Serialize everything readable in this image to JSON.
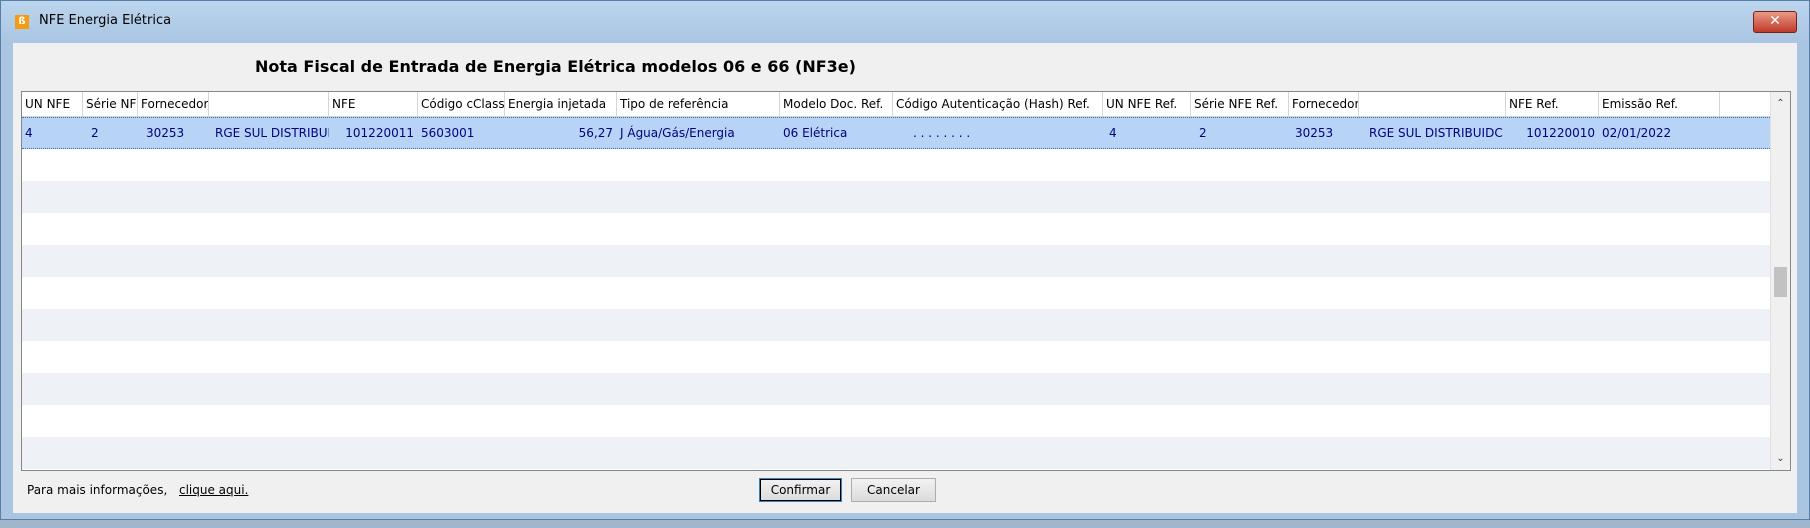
{
  "window": {
    "title": "NFE Energia Elétrica",
    "close_glyph": "✕",
    "icon": "app-logo-icon"
  },
  "heading": "Nota Fiscal de Entrada de Energia Elétrica modelos 06 e 66 (NF3e)",
  "table": {
    "columns": [
      "UN NFE",
      "Série NFE",
      "Fornecedor",
      "",
      "NFE",
      "Código cClass",
      "Energia injetada",
      "Tipo de referência",
      "Modelo Doc. Ref.",
      "Código Autenticação (Hash) Ref.",
      "UN NFE Ref.",
      "Série NFE Ref.",
      "Fornecedor Ref.",
      "",
      "NFE Ref.",
      "Emissão Ref."
    ],
    "rows": [
      [
        "4",
        "2",
        "30253",
        "RGE SUL DISTRIBUII",
        "101220011",
        "5603001",
        "56,27",
        "J Água/Gás/Energia",
        "06 Elétrica",
        ". . . . . . . .",
        "4",
        "2",
        "30253",
        "RGE SUL DISTRIBUIDC",
        "101220010",
        "02/01/2022"
      ]
    ]
  },
  "footer": {
    "info_text": "Para mais informações,",
    "link_text": "clique aqui.",
    "confirm_label": "Confirmar",
    "cancel_label": "Cancelar"
  },
  "scrollbar": {
    "up_glyph": "⌃",
    "down_glyph": "⌄"
  }
}
